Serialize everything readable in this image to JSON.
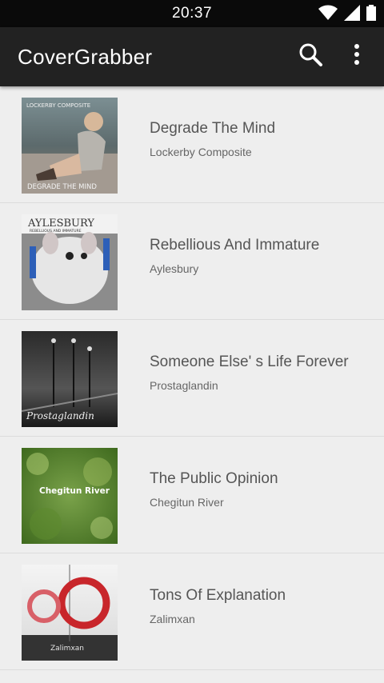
{
  "status": {
    "time": "20:37"
  },
  "app": {
    "title": "CoverGrabber"
  },
  "albums": [
    {
      "title": "Degrade The Mind",
      "artist": "Lockerby Composite",
      "cover_text": "DEGRADE THE MIND",
      "cover_top": "LOCKERBY COMPOSITE"
    },
    {
      "title": "Rebellious And Immature",
      "artist": "Aylesbury",
      "cover_text": "AYLESBURY",
      "cover_sub": "REBELLIOUS AND IMMATURE"
    },
    {
      "title": "Someone Else' s Life Forever",
      "artist": "Prostaglandin",
      "cover_text": "Prostaglandin"
    },
    {
      "title": "The Public Opinion",
      "artist": "Chegitun River",
      "cover_text": "Chegitun River"
    },
    {
      "title": "Tons Of Explanation",
      "artist": "Zalimxan",
      "cover_text": "Zalimxan"
    }
  ]
}
